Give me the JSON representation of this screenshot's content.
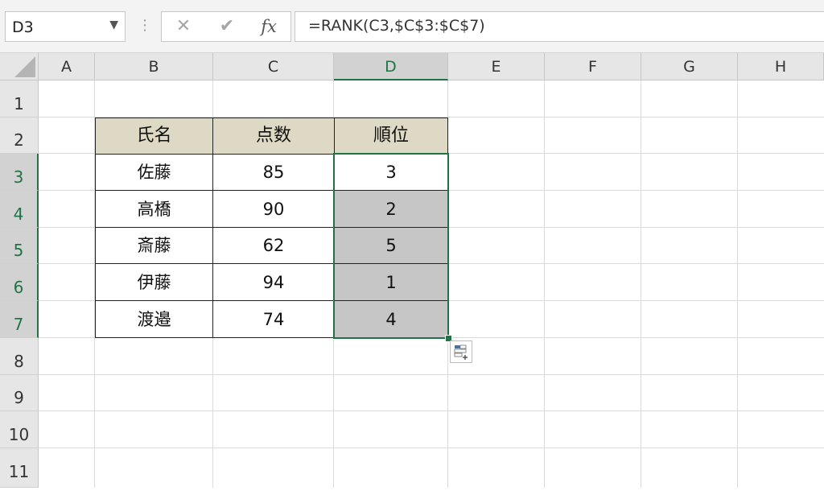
{
  "name_box": {
    "value": "D3",
    "dropdown_icon": "chevron-down-icon"
  },
  "formula_bar": {
    "cancel_icon": "close-icon",
    "cancel_glyph": "✕",
    "enter_icon": "check-icon",
    "enter_glyph": "✔",
    "fx_label": "fx",
    "formula": "=RANK(C3,$C$3:$C$7)"
  },
  "columns": [
    "A",
    "B",
    "C",
    "D",
    "E",
    "F",
    "G",
    "H"
  ],
  "rows": [
    "1",
    "2",
    "3",
    "4",
    "5",
    "6",
    "7",
    "8",
    "9",
    "10",
    "11"
  ],
  "table": {
    "headers": [
      "氏名",
      "点数",
      "順位"
    ],
    "rows": [
      [
        "佐藤",
        "85",
        "3"
      ],
      [
        "高橋",
        "90",
        "2"
      ],
      [
        "斎藤",
        "62",
        "5"
      ],
      [
        "伊藤",
        "94",
        "1"
      ],
      [
        "渡邉",
        "74",
        "4"
      ]
    ]
  },
  "selection": {
    "active_cell": "D3",
    "range": "D3:D7"
  },
  "colors": {
    "header_fill": "#ddd9c4",
    "selection_accent": "#217346",
    "selection_fill": "#c6c6c6"
  },
  "quick_analysis_icon": "quick-analysis-icon"
}
